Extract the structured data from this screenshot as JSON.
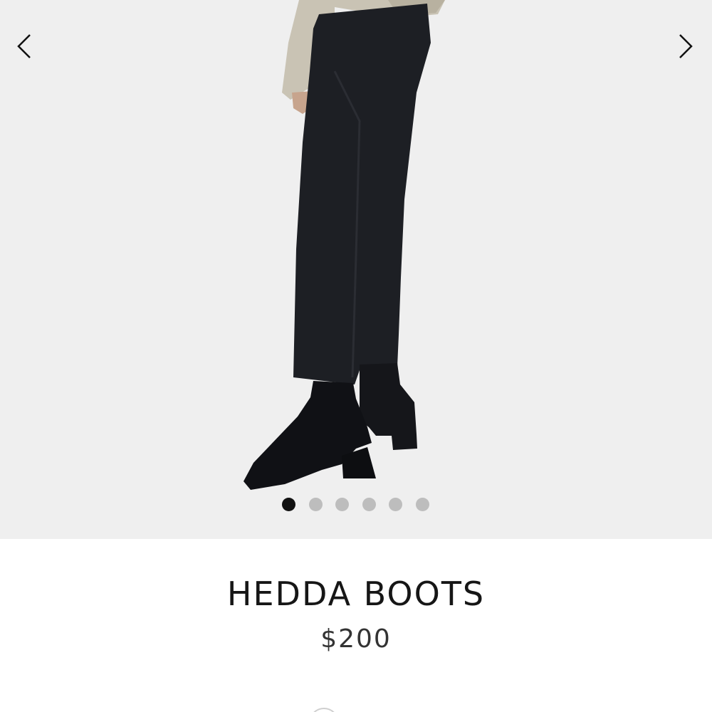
{
  "gallery": {
    "image_alt": "Model wearing black cropped trousers and black square-toe heeled ankle boots",
    "prev_icon": "chevron-left-icon",
    "next_icon": "chevron-right-icon",
    "slide_count": 6,
    "active_slide": 1
  },
  "product": {
    "name": "HEDDA BOOTS",
    "price": "$200"
  },
  "colors": {
    "background": "#efefef",
    "dot_active": "#111111",
    "dot_inactive": "#bdbdbd"
  }
}
